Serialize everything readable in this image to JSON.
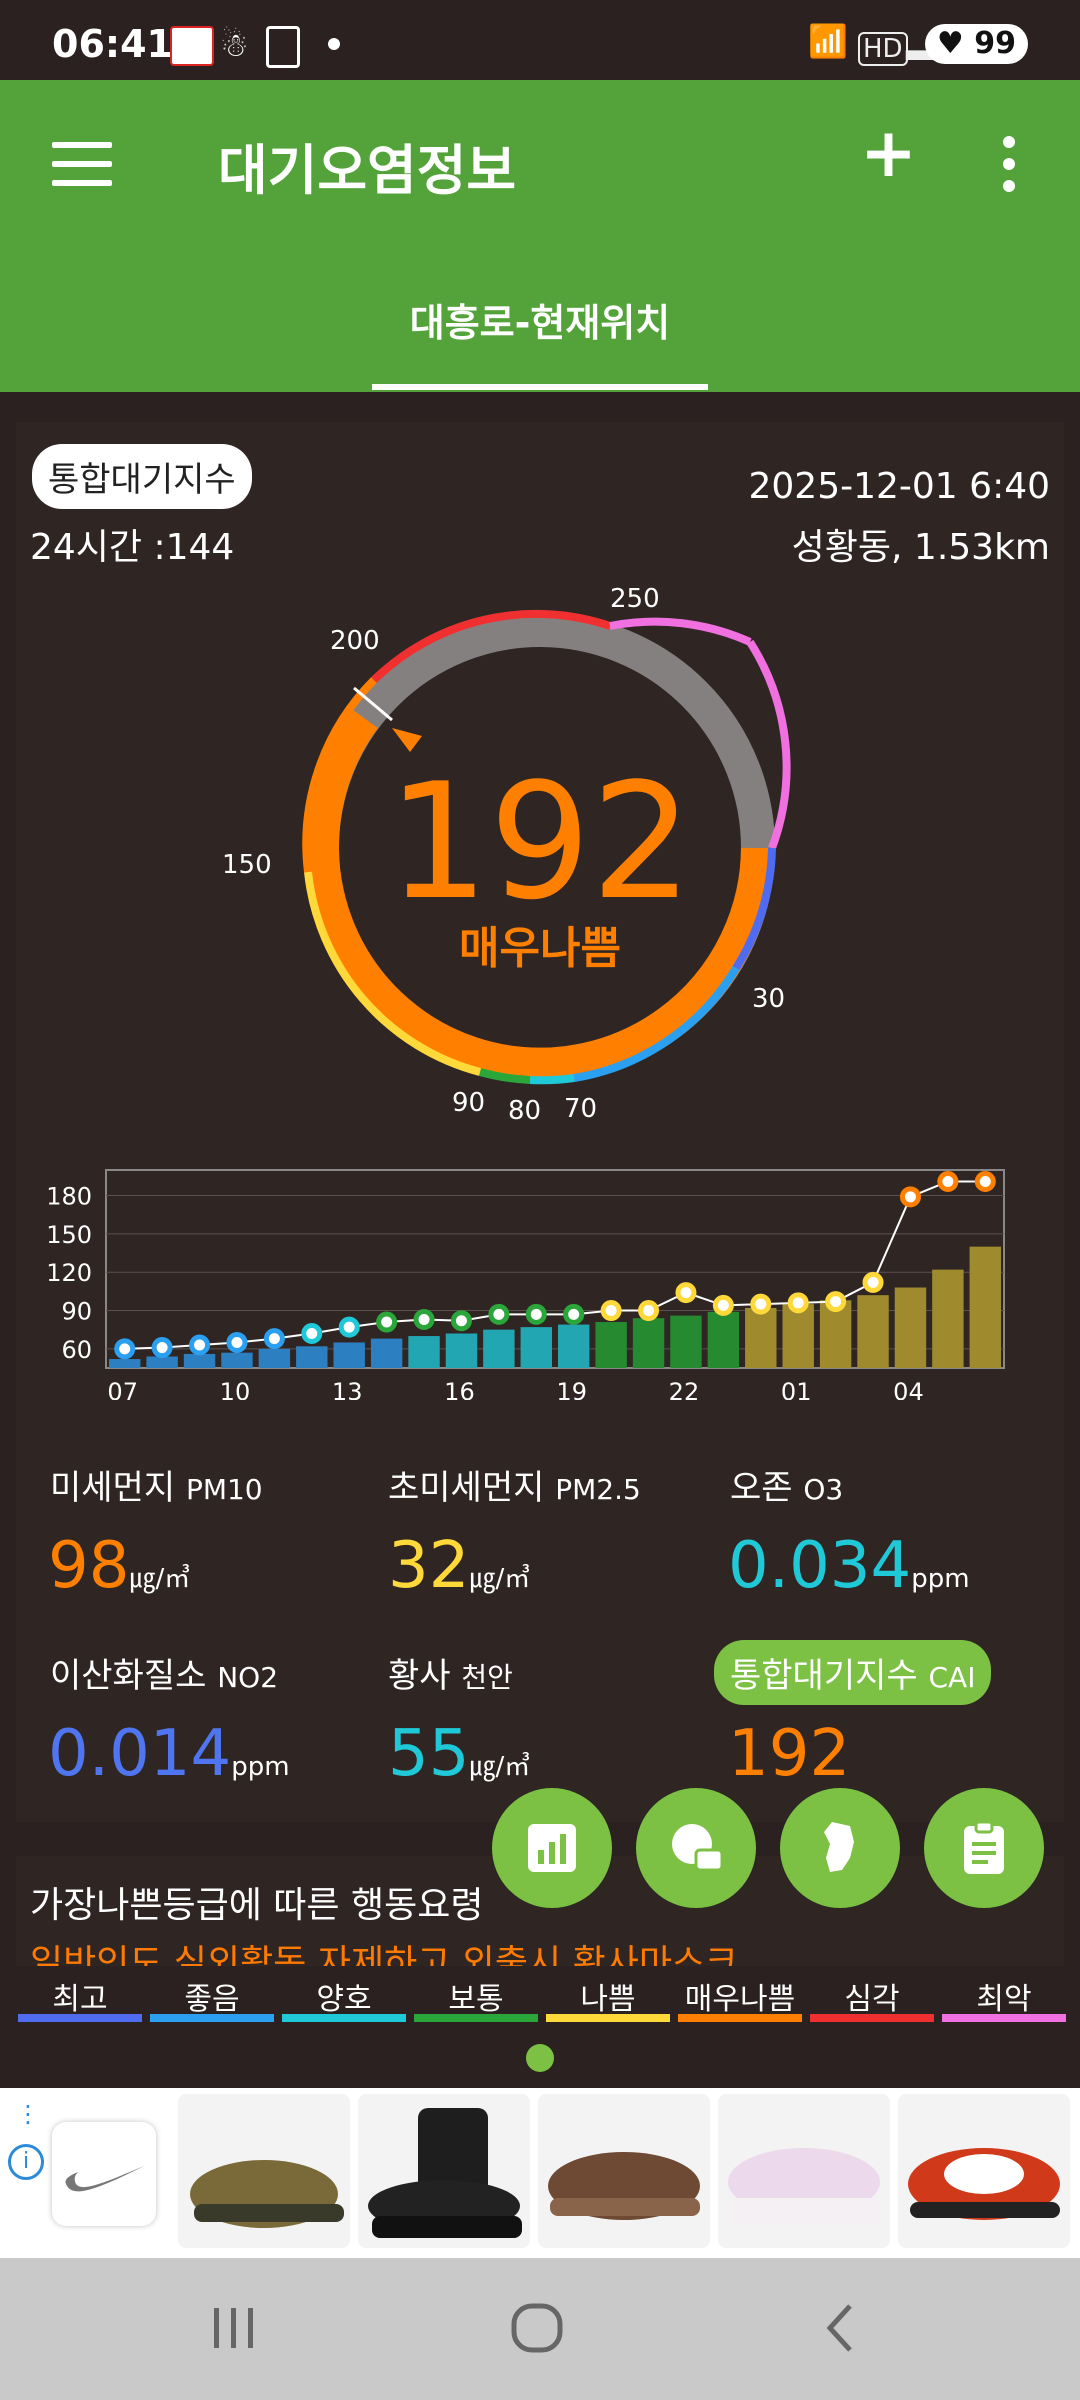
{
  "status_bar": {
    "time": "06:41",
    "battery": "99"
  },
  "app": {
    "title": "대기오염정보",
    "tab": "대흥로-현재위치"
  },
  "summary": {
    "badge": "통합대기지수",
    "avg24": "24시간 :144",
    "datetime": "2025-12-01 6:40",
    "station": "성황동, 1.53km"
  },
  "gauge": {
    "value": "192",
    "grade": "매우나쁨",
    "scale_labels": [
      "250",
      "200",
      "150",
      "90",
      "80",
      "70",
      "30"
    ]
  },
  "chart_data": {
    "type": "line",
    "x_tick_labels": [
      "07",
      "10",
      "13",
      "16",
      "19",
      "22",
      "01",
      "04"
    ],
    "ylim": [
      45,
      200
    ],
    "yticks": [
      60,
      90,
      120,
      150,
      180
    ],
    "points": [
      60,
      61,
      63,
      65,
      68,
      72,
      77,
      81,
      83,
      82,
      87,
      87,
      87,
      90,
      90,
      104,
      94,
      95,
      96,
      97,
      112,
      179,
      191,
      191
    ],
    "bars": [
      52,
      54,
      56,
      57,
      60,
      62,
      65,
      68,
      70,
      72,
      75,
      77,
      79,
      81,
      84,
      86,
      89,
      92,
      95,
      98,
      102,
      108,
      122,
      140
    ]
  },
  "pollutants": [
    {
      "name": "미세먼지",
      "code": "PM10",
      "value": "98",
      "unit": "㎍/㎥",
      "color": "#ff8000"
    },
    {
      "name": "초미세먼지",
      "code": "PM2.5",
      "value": "32",
      "unit": "㎍/㎥",
      "color": "#ffd83a"
    },
    {
      "name": "오존",
      "code": "O3",
      "value": "0.034",
      "unit": "ppm",
      "color": "#20c9d8"
    },
    {
      "name": "이산화질소",
      "code": "NO2",
      "value": "0.014",
      "unit": "ppm",
      "color": "#4f76f0"
    },
    {
      "name": "황사",
      "code": "천안",
      "value": "55",
      "unit": "㎍/㎥",
      "color": "#20c9d8"
    },
    {
      "name": "통합대기지수",
      "code": "CAI",
      "value": "192",
      "unit": "",
      "color": "#ff8000"
    }
  ],
  "info": {
    "line1": "가장나쁜등급에 따른 행동요령",
    "line2": "일반인도 실외활동 자제하고 외출시 황사마스크"
  },
  "legend": [
    {
      "label": "최고",
      "color": "#4f6bf0"
    },
    {
      "label": "좋음",
      "color": "#2ba0f0"
    },
    {
      "label": "양호",
      "color": "#20c9d8"
    },
    {
      "label": "보통",
      "color": "#2aa63a"
    },
    {
      "label": "나쁨",
      "color": "#ffd83a"
    },
    {
      "label": "매우나쁨",
      "color": "#ff8000"
    },
    {
      "label": "심각",
      "color": "#f03030"
    },
    {
      "label": "최악",
      "color": "#f070e0"
    }
  ]
}
